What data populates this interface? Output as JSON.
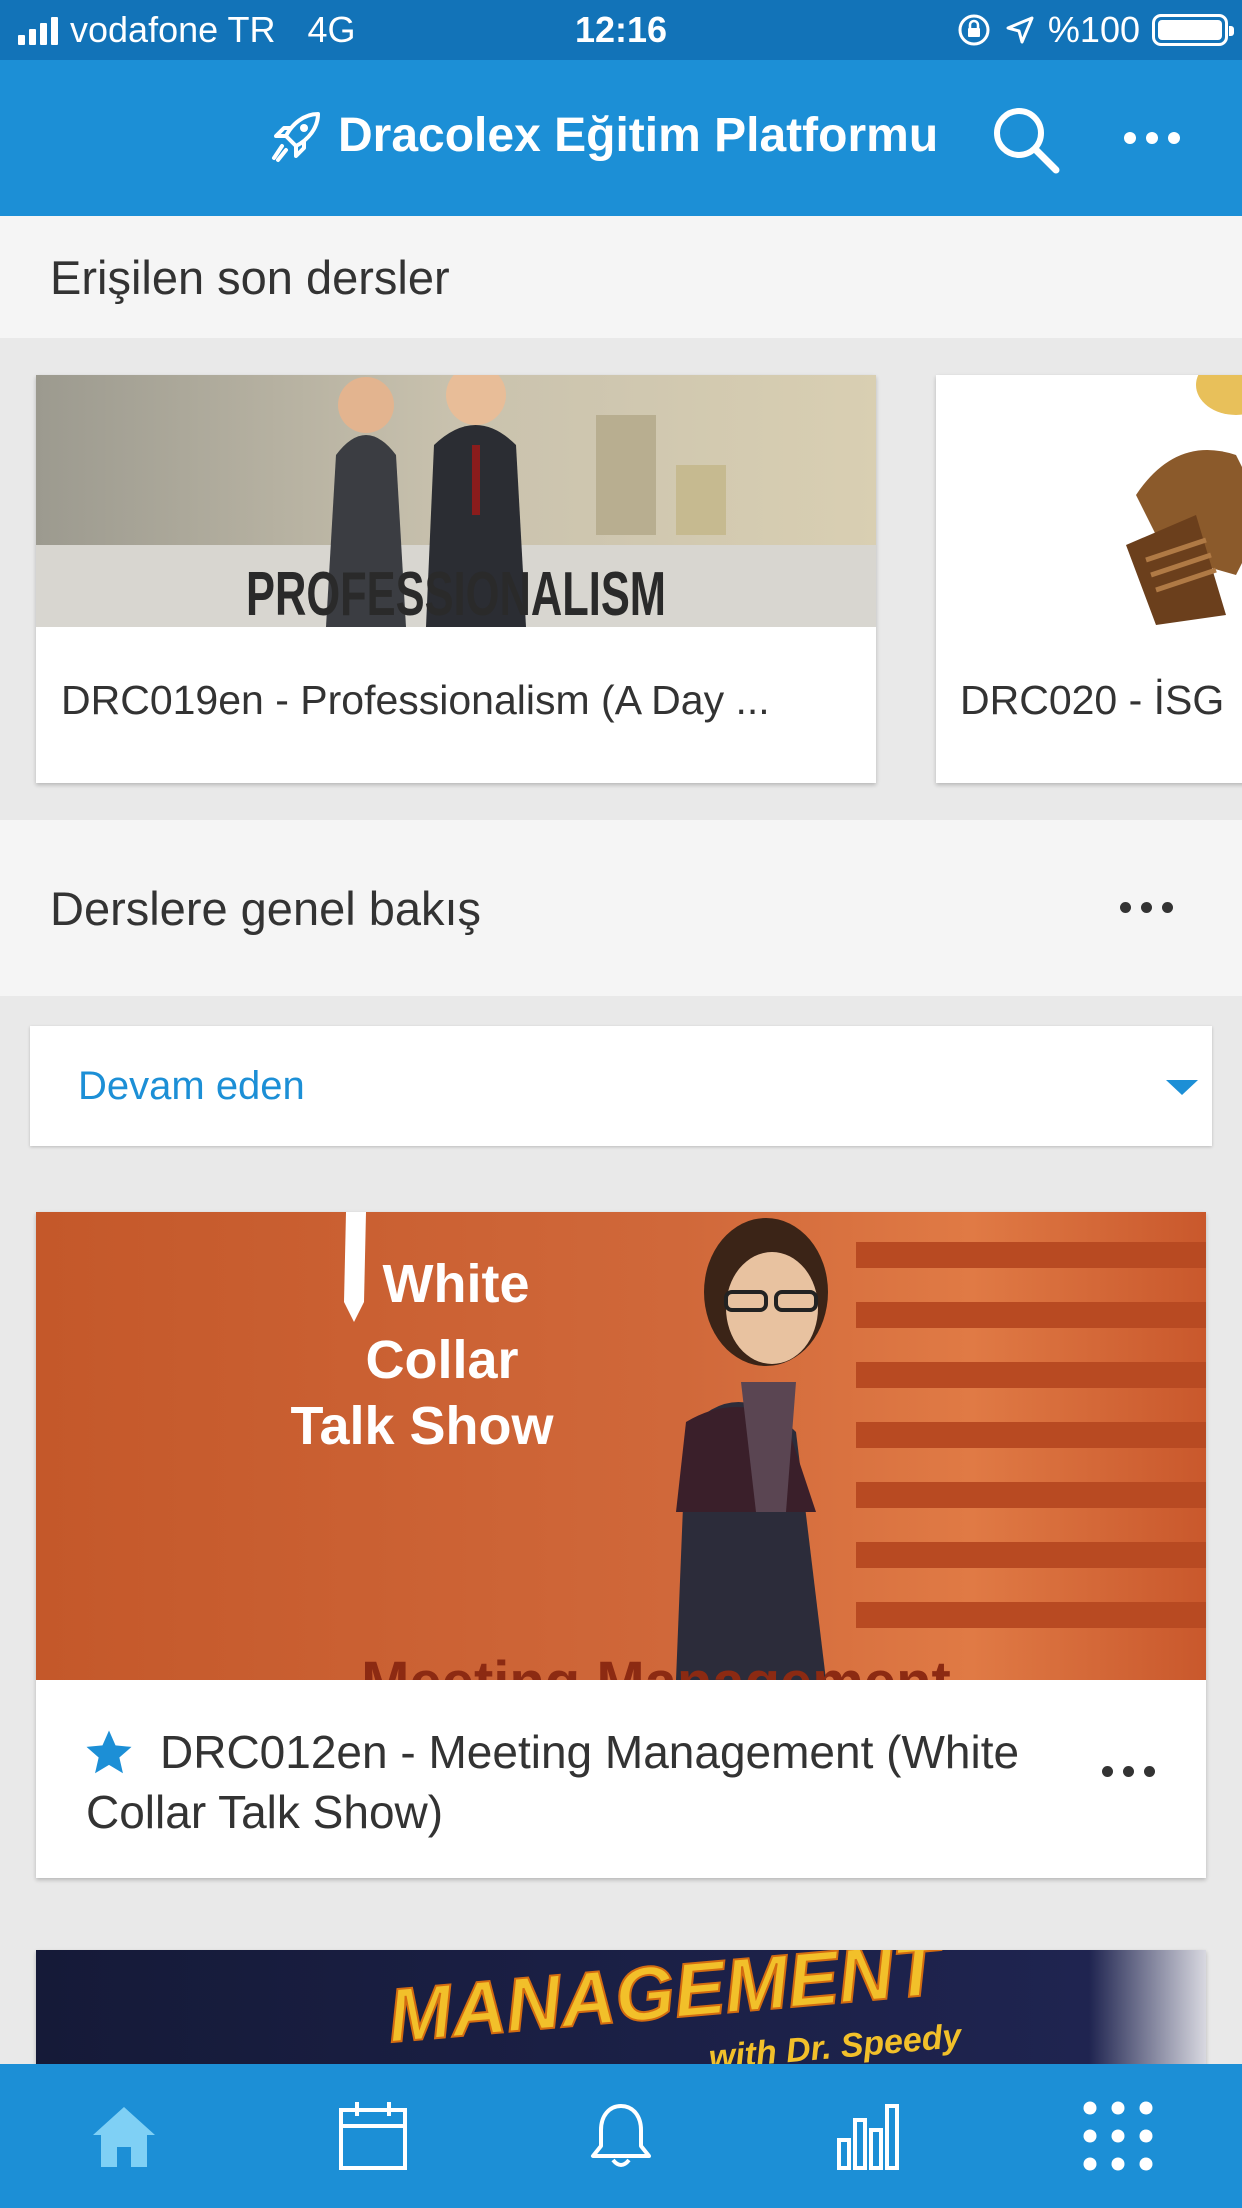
{
  "status_bar": {
    "carrier": "vodafone TR",
    "network": "4G",
    "time": "12:16",
    "battery": "%100",
    "battery_level": 1.0
  },
  "app_bar": {
    "title": "Dracolex Eğitim Platformu",
    "icons": [
      "rocket-icon",
      "search-icon",
      "more-icon"
    ]
  },
  "recent": {
    "heading": "Erişilen son dersler",
    "courses": [
      {
        "title": "DRC019en - Professionalism (A Day ...",
        "image_text": "PROFESSIONALISM"
      },
      {
        "title": "DRC020 - İSG"
      }
    ]
  },
  "overview": {
    "heading": "Derslere genel bakış",
    "filter_value": "Devam eden",
    "courses": [
      {
        "title": "DRC012en - Meeting Management (White Collar Talk Show)",
        "starred": true,
        "image_lines": [
          "White",
          "Collar",
          "Talk Show"
        ],
        "image_footer": "Meeting Management"
      },
      {
        "image_text": "MANAGEMENT",
        "image_subtext": "with Dr. Speedy"
      }
    ]
  },
  "bottom_nav": {
    "items": [
      "home-icon",
      "calendar-icon",
      "bell-icon",
      "bar-chart-icon",
      "grid-icon"
    ]
  },
  "colors": {
    "status_bar": "#1273b8",
    "app_bar": "#1c8fd6",
    "accent": "#1c8fd6",
    "active_tab": "#7fd0f5"
  }
}
